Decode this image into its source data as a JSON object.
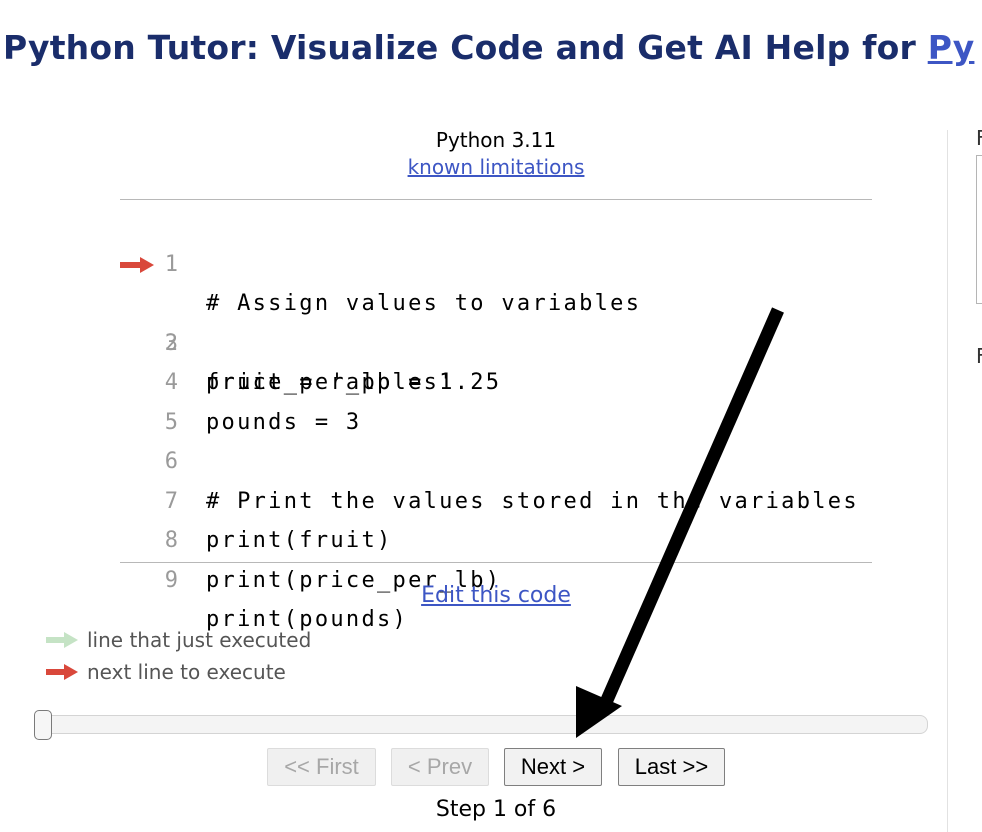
{
  "header": {
    "title_prefix": "Python Tutor: Visualize Code and Get AI Help for ",
    "title_link": "Py"
  },
  "editor": {
    "language": "Python 3.11",
    "limitations_link": "known limitations",
    "lines": [
      {
        "num": "1",
        "text": "# Assign values to variables"
      },
      {
        "num": "2",
        "text": "fruit = 'apples'"
      },
      {
        "num": "3",
        "text": "price_per_lb = 1.25"
      },
      {
        "num": "4",
        "text": "pounds = 3"
      },
      {
        "num": "5",
        "text": ""
      },
      {
        "num": "6",
        "text": "# Print the values stored in the variables"
      },
      {
        "num": "7",
        "text": "print(fruit)"
      },
      {
        "num": "8",
        "text": "print(price_per_lb)"
      },
      {
        "num": "9",
        "text": "print(pounds)"
      }
    ],
    "current_line": 2,
    "edit_link": "Edit this code"
  },
  "legend": {
    "executed_label": "line that just executed",
    "next_label": "next line to execute",
    "executed_color": "#c5e3c5",
    "next_color": "#d9483b"
  },
  "navigation": {
    "first_label": "<< First",
    "prev_label": "< Prev",
    "next_label": "Next >",
    "last_label": "Last >>",
    "step_text": "Step 1 of 6",
    "progress": 0
  },
  "right_panel": {
    "glyph_top": "F",
    "glyph_bottom": "F"
  }
}
